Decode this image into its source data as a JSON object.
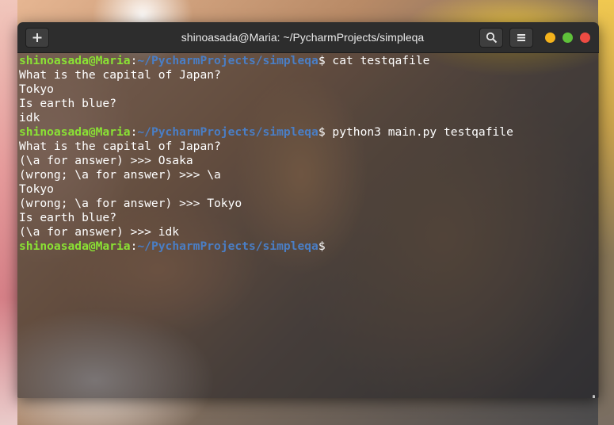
{
  "window": {
    "title": "shinoasada@Maria: ~/PycharmProjects/simpleqa"
  },
  "titlebar": {
    "icons": [
      "plus-icon",
      "search-icon",
      "hamburger-menu-icon"
    ],
    "window_controls": {
      "minimize_color": "#f5b31c",
      "maximize_color": "#5fc13a",
      "close_color": "#ee4b43"
    }
  },
  "prompt": {
    "user_host": "shinoasada@Maria",
    "separator": ":",
    "path": "~/PycharmProjects/simpleqa",
    "symbol": "$",
    "user_color": "#8ae234",
    "path_color": "#4a7ec5"
  },
  "terminal": {
    "lines": [
      {
        "type": "prompt",
        "command": " cat testqafile"
      },
      {
        "type": "output",
        "text": "What is the capital of Japan?"
      },
      {
        "type": "output",
        "text": "Tokyo"
      },
      {
        "type": "output",
        "text": "Is earth blue?"
      },
      {
        "type": "output",
        "text": "idk"
      },
      {
        "type": "prompt",
        "command": " python3 main.py testqafile"
      },
      {
        "type": "output",
        "text": "What is the capital of Japan?"
      },
      {
        "type": "output",
        "text": "(\\a for answer) >>> Osaka"
      },
      {
        "type": "output",
        "text": "(wrong; \\a for answer) >>> \\a"
      },
      {
        "type": "output",
        "text": "Tokyo"
      },
      {
        "type": "output",
        "text": "(wrong; \\a for answer) >>> Tokyo"
      },
      {
        "type": "output",
        "text": "Is earth blue?"
      },
      {
        "type": "output",
        "text": "(\\a for answer) >>> idk"
      },
      {
        "type": "prompt",
        "command": ""
      }
    ]
  }
}
